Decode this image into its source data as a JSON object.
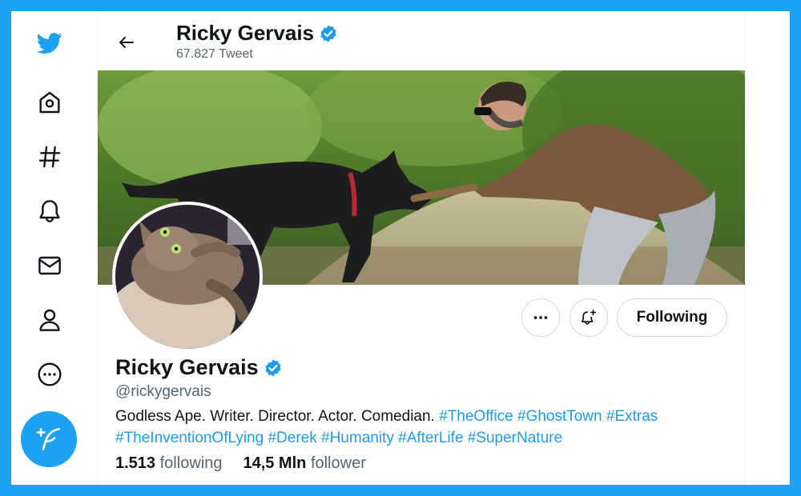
{
  "colors": {
    "accent": "#1da1f2",
    "link": "#1d9bf0",
    "text": "#0f1419",
    "muted": "#536471"
  },
  "nav": {
    "items": [
      {
        "icon": "twitter-bird-icon"
      },
      {
        "icon": "home-icon"
      },
      {
        "icon": "explore-hashtag-icon"
      },
      {
        "icon": "notifications-bell-icon"
      },
      {
        "icon": "messages-envelope-icon"
      },
      {
        "icon": "profile-icon"
      },
      {
        "icon": "more-circle-icon"
      }
    ],
    "compose_icon": "compose-tweet-icon"
  },
  "header": {
    "name": "Ricky Gervais",
    "tweet_count": "67.827 Tweet"
  },
  "profile": {
    "name": "Ricky Gervais",
    "handle": "@rickygervais",
    "bio_text": "Godless Ape. Writer. Director. Actor. Comedian. ",
    "bio_tags": [
      "#TheOffice",
      "#GhostTown",
      "#Extras",
      "#TheInventionOfLying",
      "#Derek",
      "#Humanity",
      "#AfterLife",
      "#SuperNature"
    ],
    "following_count": "1.513",
    "following_label": "following",
    "follower_count": "14,5 Mln",
    "follower_label": "follower"
  },
  "actions": {
    "more_icon": "more-dots-icon",
    "notify_icon": "bell-plus-icon",
    "following_label": "Following"
  }
}
